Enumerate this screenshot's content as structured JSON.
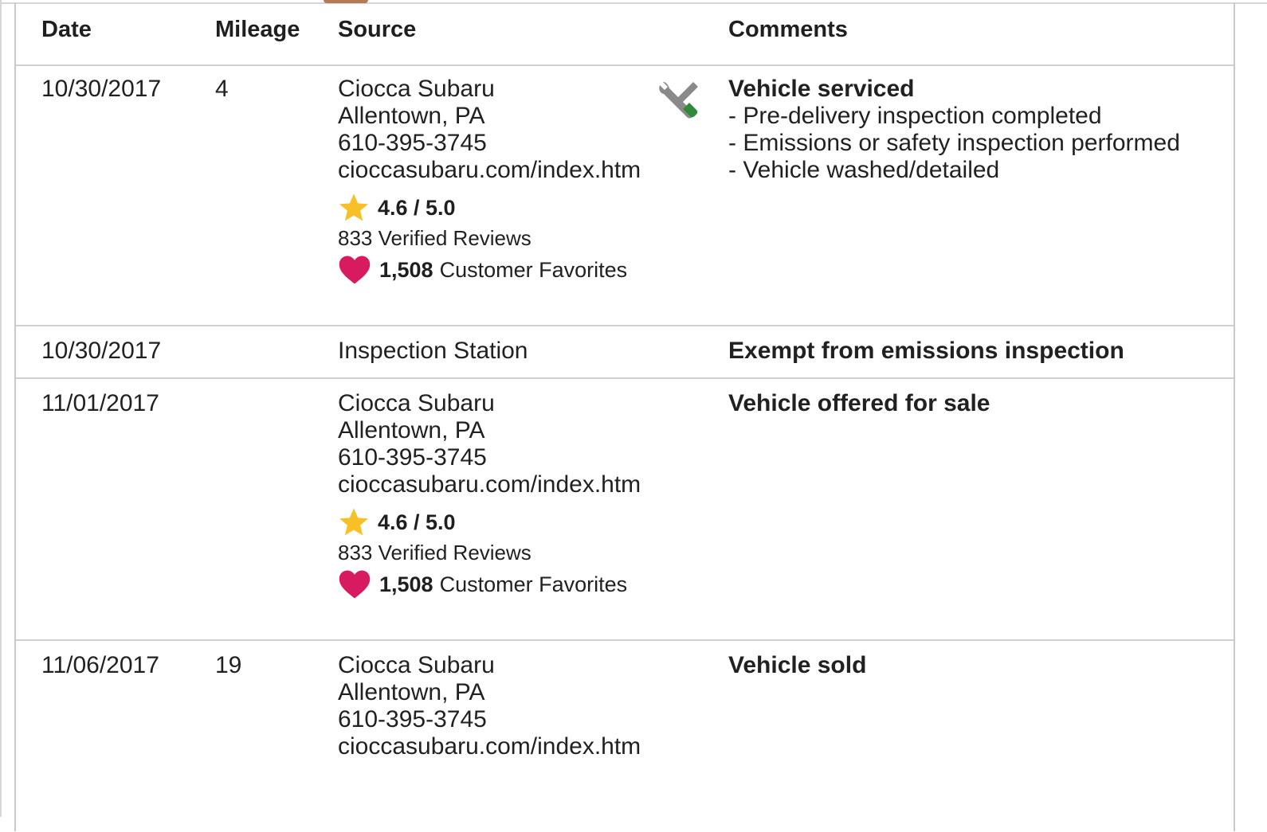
{
  "table": {
    "headers": {
      "date": "Date",
      "mileage": "Mileage",
      "source": "Source",
      "comments": "Comments"
    },
    "rows": [
      {
        "date": "10/30/2017",
        "mileage": "4",
        "source": {
          "name": "Ciocca Subaru",
          "location": "Allentown, PA",
          "phone": "610-395-3745",
          "url": "cioccasubaru.com/index.htm",
          "rating": "4.6 / 5.0",
          "reviews": "833 Verified Reviews",
          "favorites_count": "1,508",
          "favorites_label": "Customer Favorites"
        },
        "icon": "wrench-screwdriver-icon",
        "comments": {
          "title": "Vehicle serviced",
          "items": [
            "- Pre-delivery inspection completed",
            "- Emissions or safety inspection performed",
            "- Vehicle washed/detailed"
          ]
        }
      },
      {
        "date": "10/30/2017",
        "mileage": "",
        "source": {
          "name": "Inspection Station"
        },
        "comments": {
          "title": "Exempt from emissions inspection"
        }
      },
      {
        "date": "11/01/2017",
        "mileage": "",
        "source": {
          "name": "Ciocca Subaru",
          "location": "Allentown, PA",
          "phone": "610-395-3745",
          "url": "cioccasubaru.com/index.htm",
          "rating": "4.6 / 5.0",
          "reviews": "833 Verified Reviews",
          "favorites_count": "1,508",
          "favorites_label": "Customer Favorites"
        },
        "comments": {
          "title": "Vehicle offered for sale"
        }
      },
      {
        "date": "11/06/2017",
        "mileage": "19",
        "source": {
          "name": "Ciocca Subaru",
          "location": "Allentown, PA",
          "phone": "610-395-3745",
          "url": "cioccasubaru.com/index.htm"
        },
        "comments": {
          "title": "Vehicle sold"
        }
      }
    ]
  },
  "colors": {
    "star": "#F6C026",
    "heart": "#D81B60",
    "tool_gray": "#8A8A8A",
    "tool_green": "#2E8B3A",
    "border": "#CFCFCF"
  }
}
